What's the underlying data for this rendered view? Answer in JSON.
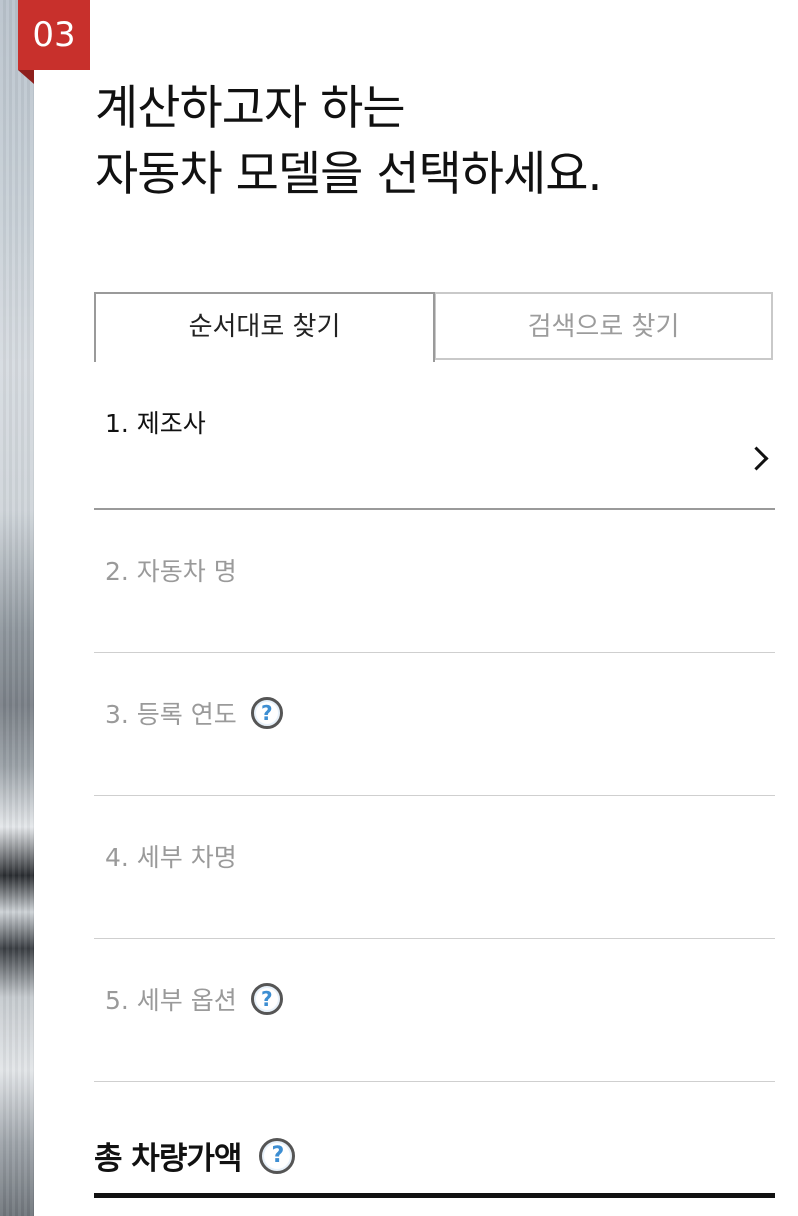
{
  "step_badge": "03",
  "headline": {
    "line1": "계산하고자 하는",
    "line2": "자동차 모델을 선택하세요."
  },
  "tabs": [
    {
      "label": "순서대로 찾기",
      "active": true
    },
    {
      "label": "검색으로 찾기",
      "active": false
    }
  ],
  "steps": [
    {
      "label": "1. 제조사",
      "active": true,
      "has_help": false,
      "has_chevron": true
    },
    {
      "label": "2. 자동차 명",
      "active": false,
      "has_help": false
    },
    {
      "label": "3. 등록 연도",
      "active": false,
      "has_help": true
    },
    {
      "label": "4. 세부 차명",
      "active": false,
      "has_help": false
    },
    {
      "label": "5. 세부 옵션",
      "active": false,
      "has_help": true
    }
  ],
  "help_icon_glyph": "?",
  "total": {
    "label": "총 차량가액"
  },
  "colors": {
    "badge": "#c8302c",
    "help_icon_accent": "#3d8ed2",
    "inactive_text": "#9a9a9a"
  }
}
